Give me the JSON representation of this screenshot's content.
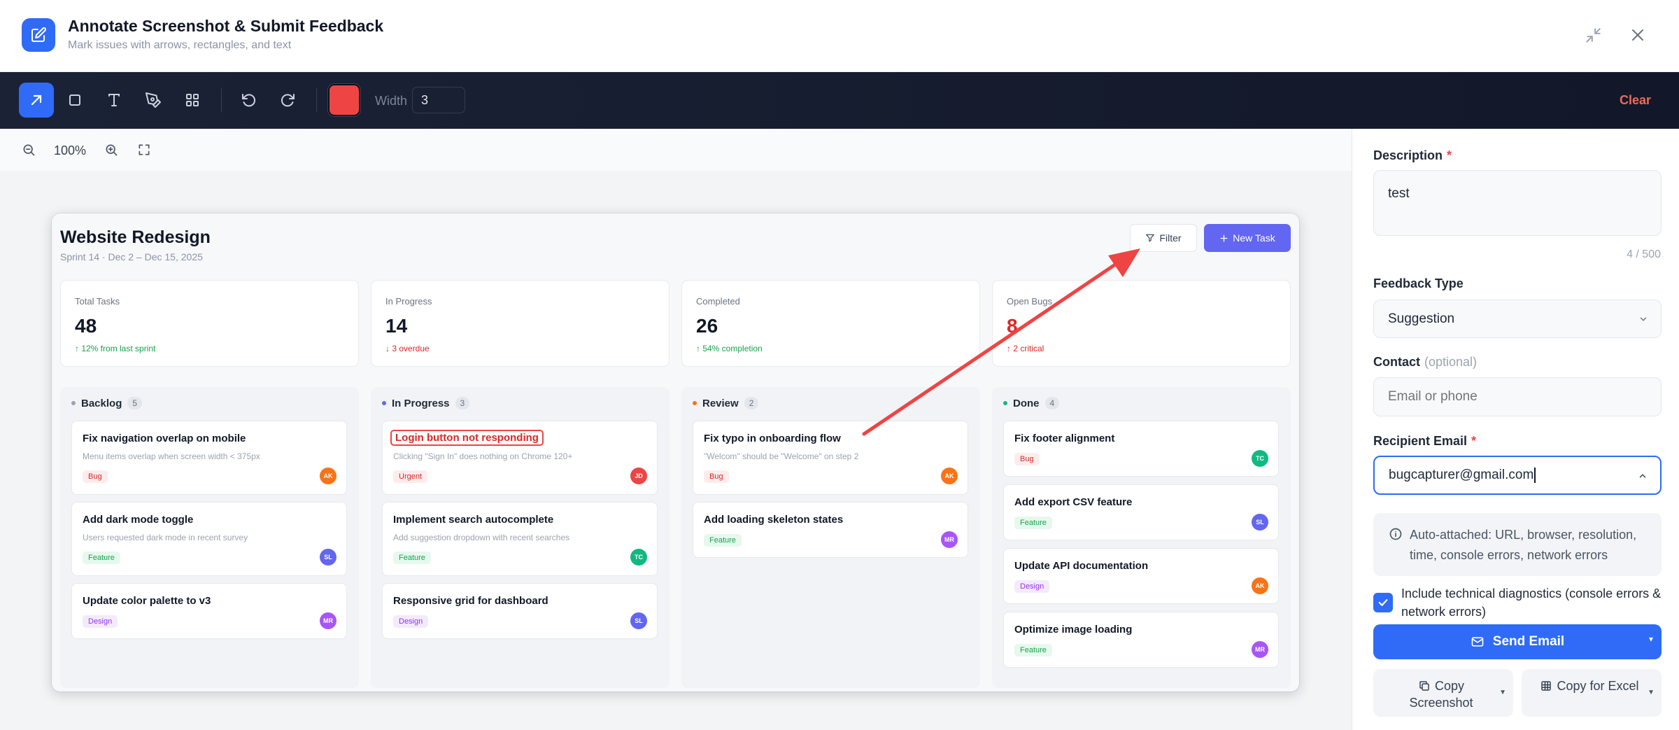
{
  "header": {
    "title": "Annotate Screenshot & Submit Feedback",
    "subtitle": "Mark issues with arrows, rectangles, and text"
  },
  "toolbar": {
    "tools": [
      {
        "name": "arrow",
        "icon": "arrow-icon",
        "active": true
      },
      {
        "name": "rectangle",
        "icon": "rectangle-icon",
        "active": false
      },
      {
        "name": "text",
        "icon": "text-icon",
        "active": false
      },
      {
        "name": "pen",
        "icon": "pen-icon",
        "active": false
      },
      {
        "name": "pixelate",
        "icon": "grid-icon",
        "active": false
      }
    ],
    "color": "#ef4444",
    "width_label": "Width",
    "width_value": "3",
    "clear_label": "Clear"
  },
  "zoom": {
    "level": "100%"
  },
  "screenshot": {
    "title": "Website Redesign",
    "subtitle": "Sprint 14 · Dec 2 – Dec 15, 2025",
    "filter_label": "Filter",
    "new_task_label": "New Task",
    "stats": [
      {
        "label": "Total Tasks",
        "value": "48",
        "note": "↑ 12% from last sprint",
        "note_color": "#16a34a"
      },
      {
        "label": "In Progress",
        "value": "14",
        "note": "↓ 3 overdue",
        "note_color": "#dc2626"
      },
      {
        "label": "Completed",
        "value": "26",
        "note": "↑ 54% completion",
        "note_color": "#16a34a"
      },
      {
        "label": "Open Bugs",
        "value": "8",
        "note": "↑ 2 critical",
        "note_color": "#dc2626"
      }
    ],
    "columns": [
      {
        "name": "Backlog",
        "count": "5",
        "dot": "#9ca3af",
        "tasks": [
          {
            "title": "Fix navigation overlap on mobile",
            "desc": "Menu items overlap when screen width < 375px",
            "tag": "Bug",
            "tag_type": "bug",
            "avatar": "AK",
            "avatar_color": "#f97316"
          },
          {
            "title": "Add dark mode toggle",
            "desc": "Users requested dark mode in recent survey",
            "tag": "Feature",
            "tag_type": "feature",
            "avatar": "SL",
            "avatar_color": "#6366f1"
          },
          {
            "title": "Update color palette to v3",
            "desc": "",
            "tag": "Design",
            "tag_type": "design",
            "avatar": "MR",
            "avatar_color": "#a855f7"
          }
        ]
      },
      {
        "name": "In Progress",
        "count": "3",
        "dot": "#6366f1",
        "tasks": [
          {
            "title": "Login button not responding",
            "desc": "Clicking \"Sign In\" does nothing on Chrome 120+",
            "tag": "Urgent",
            "tag_type": "urgent",
            "avatar": "JD",
            "avatar_color": "#ef4444",
            "flag": true
          },
          {
            "title": "Implement search autocomplete",
            "desc": "Add suggestion dropdown with recent searches",
            "tag": "Feature",
            "tag_type": "feature",
            "avatar": "TC",
            "avatar_color": "#10b981"
          },
          {
            "title": "Responsive grid for dashboard",
            "desc": "",
            "tag": "Design",
            "tag_type": "design",
            "avatar": "SL",
            "avatar_color": "#6366f1"
          }
        ]
      },
      {
        "name": "Review",
        "count": "2",
        "dot": "#f97316",
        "tasks": [
          {
            "title": "Fix typo in onboarding flow",
            "desc": "\"Welcom\" should be \"Welcome\" on step 2",
            "tag": "Bug",
            "tag_type": "bug",
            "avatar": "AK",
            "avatar_color": "#f97316"
          },
          {
            "title": "Add loading skeleton states",
            "desc": "",
            "tag": "Feature",
            "tag_type": "feature",
            "avatar": "MR",
            "avatar_color": "#a855f7"
          }
        ]
      },
      {
        "name": "Done",
        "count": "4",
        "dot": "#10b981",
        "tasks": [
          {
            "title": "Fix footer alignment",
            "desc": "",
            "tag": "Bug",
            "tag_type": "bug",
            "avatar": "TC",
            "avatar_color": "#10b981"
          },
          {
            "title": "Add export CSV feature",
            "desc": "",
            "tag": "Feature",
            "tag_type": "feature",
            "avatar": "SL",
            "avatar_color": "#6366f1"
          },
          {
            "title": "Update API documentation",
            "desc": "",
            "tag": "Design",
            "tag_type": "design",
            "avatar": "AK",
            "avatar_color": "#f97316"
          },
          {
            "title": "Optimize image loading",
            "desc": "",
            "tag": "Feature",
            "tag_type": "feature",
            "avatar": "MR",
            "avatar_color": "#a855f7"
          }
        ]
      }
    ]
  },
  "panel": {
    "description_label": "Description",
    "required_mark": "*",
    "description_value": "test",
    "char_counter": "4 / 500",
    "feedback_type_label": "Feedback Type",
    "feedback_type_value": "Suggestion",
    "contact_label": "Contact",
    "contact_optional": "(optional)",
    "contact_placeholder": "Email or phone",
    "recipient_label": "Recipient Email",
    "recipient_value": "bugcapturer@gmail.com",
    "info_text": "Auto-attached: URL, browser, resolution, time, console errors, network errors",
    "diagnostics_label": "Include technical diagnostics (console errors & network errors)",
    "diagnostics_checked": true,
    "send_label": "Send Email",
    "copy_screenshot_label": "Copy Screenshot",
    "copy_excel_label": "Copy for Excel"
  }
}
